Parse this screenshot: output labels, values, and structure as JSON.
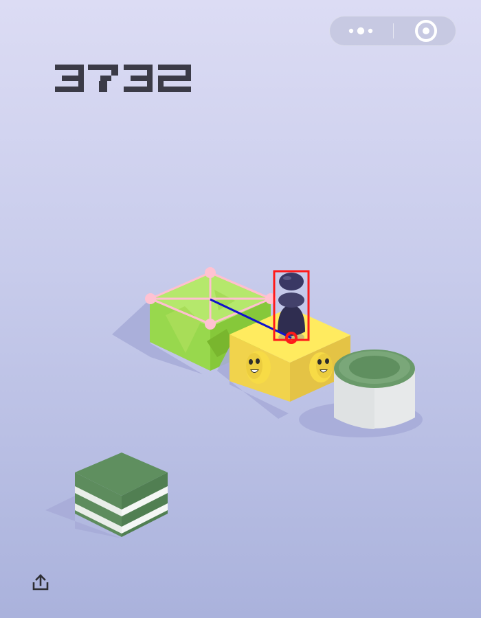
{
  "game": {
    "score": "3732",
    "player_color": "#2f2d50",
    "target_platform": "green-gem-box",
    "current_platform": "yellow-smiley-box"
  },
  "capsule": {
    "more_icon": "more-dots-icon",
    "close_icon": "target-circle-icon"
  },
  "colors": {
    "green_box_top": "#b7e86a",
    "green_box_front": "#8ed143",
    "yellow_box_top": "#ffe95e",
    "yellow_box_front": "#f1d54a",
    "cylinder_top": "#5c8f60",
    "cylinder_side": "#e5e7e7",
    "stack_green": "#5f8d5f",
    "stack_white": "#e9eee9",
    "shadow": "#a7acd8",
    "overlay_pink": "#ffbfd0",
    "overlay_blue": "#1111cc",
    "overlay_red": "#ff1a1a"
  },
  "icons": {
    "share": "share-icon"
  }
}
